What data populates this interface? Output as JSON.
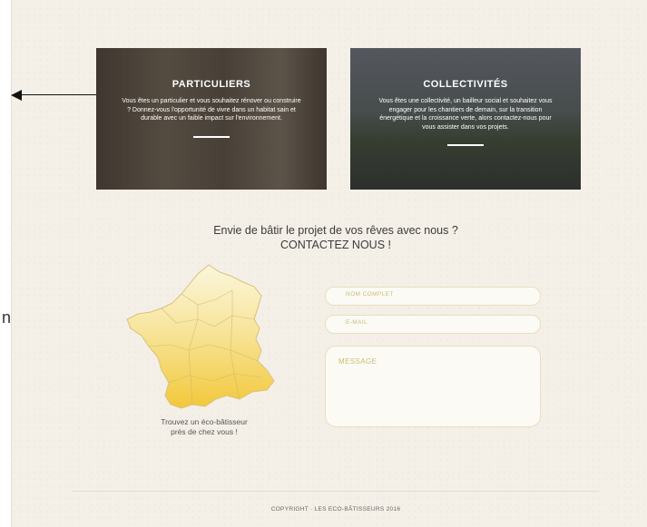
{
  "cards": [
    {
      "title": "PARTICULIERS",
      "text": "Vous êtes un particulier et vous souhaitez rénover ou construire ? Donnez-vous l'opportunité de vivre dans un habitat sain et durable avec un faible impact sur l'environnement."
    },
    {
      "title": "COLLECTIVITÉS",
      "text": "Vous êtes une collectivité, un bailleur social et souhaitez vous engager pour les chantiers de demain, sur la transition énergétique et la croissance verte, alors contactez-nous pour vous assister dans vos projets."
    }
  ],
  "headline": {
    "line1": "Envie de bâtir le projet de vos rêves avec nous ?",
    "line2": "CONTACTEZ NOUS !"
  },
  "map": {
    "caption_line1": "Trouvez un éco-bâtisseur",
    "caption_line2": "près de chez vous !"
  },
  "form": {
    "name_placeholder": "NOM COMPLET",
    "email_placeholder": "E-MAIL",
    "message_placeholder": "MESSAGE"
  },
  "stray_text": "n",
  "footer": {
    "copyright": "COPYRIGHT · LES ECO-BÂTISSEURS 2016"
  }
}
